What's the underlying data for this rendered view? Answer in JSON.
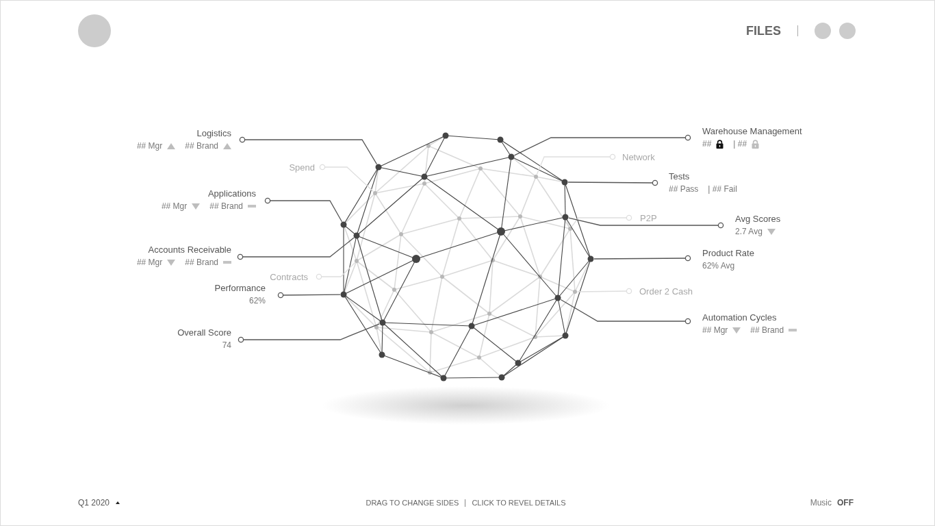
{
  "header": {
    "title": "FILES"
  },
  "left_callouts": [
    {
      "label": "Logistics",
      "dimmed": false,
      "metrics": [
        {
          "text": "## Mgr",
          "kind": "up"
        },
        {
          "text": "## Brand",
          "kind": "up"
        }
      ]
    },
    {
      "label": "Spend",
      "dimmed": true
    },
    {
      "label": "Applications",
      "dimmed": false,
      "metrics": [
        {
          "text": "## Mgr",
          "kind": "down"
        },
        {
          "text": "## Brand",
          "kind": "flat"
        }
      ]
    },
    {
      "label": "Accounts Receivable",
      "dimmed": false,
      "metrics": [
        {
          "text": "## Mgr",
          "kind": "down"
        },
        {
          "text": "## Brand",
          "kind": "flat"
        }
      ]
    },
    {
      "label": "Contracts",
      "dimmed": true
    },
    {
      "label": "Performance",
      "dimmed": false,
      "metrics": [
        {
          "text": "62%",
          "kind": "plain"
        }
      ]
    },
    {
      "label": "Overall Score",
      "dimmed": false,
      "metrics": [
        {
          "text": "74",
          "kind": "plain"
        }
      ]
    }
  ],
  "right_callouts": [
    {
      "label": "Warehouse Management",
      "dimmed": false,
      "metrics": [
        {
          "text": "##",
          "kind": "lock",
          "color": "#111111"
        },
        {
          "text": "| ##",
          "kind": "lock",
          "color": "#bdbdbd"
        }
      ]
    },
    {
      "label": "Network",
      "dimmed": true
    },
    {
      "label": "Tests",
      "dimmed": false,
      "metrics": [
        {
          "text": "## Pass",
          "kind": "plain"
        },
        {
          "text": "| ## Fail",
          "kind": "plain"
        }
      ]
    },
    {
      "label": "P2P",
      "dimmed": true
    },
    {
      "label": "Avg Scores",
      "dimmed": false,
      "metrics": [
        {
          "text": "2.7 Avg",
          "kind": "down"
        }
      ]
    },
    {
      "label": "Product Rate",
      "dimmed": false,
      "metrics": [
        {
          "text": "62% Avg",
          "kind": "plain"
        }
      ]
    },
    {
      "label": "Order 2 Cash",
      "dimmed": true
    },
    {
      "label": "Automation Cycles",
      "dimmed": false,
      "metrics": [
        {
          "text": "## Mgr",
          "kind": "down"
        },
        {
          "text": "## Brand",
          "kind": "flat"
        }
      ]
    }
  ],
  "footer": {
    "period": "Q1 2020",
    "hints": [
      "DRAG TO CHANGE SIDES",
      "CLICK TO REVEL DETAILS"
    ],
    "music_label": "Music",
    "music_value": "OFF"
  }
}
